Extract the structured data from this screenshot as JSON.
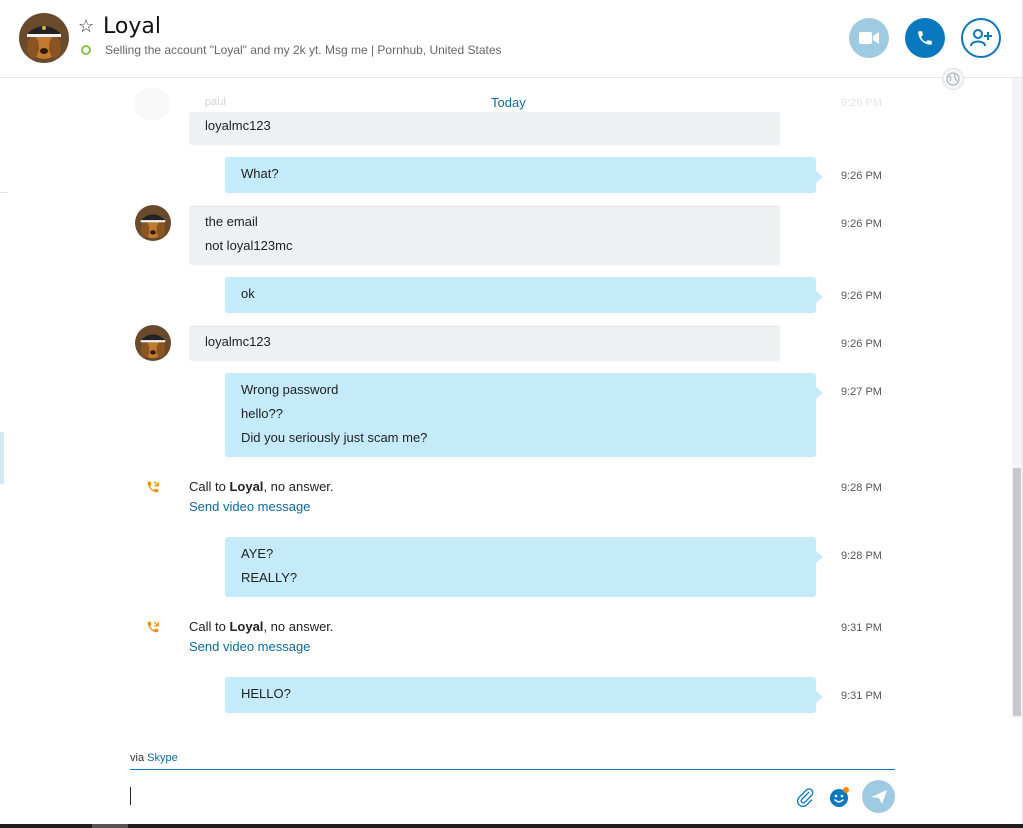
{
  "header": {
    "contact_name": "Loyal",
    "mood_message": "Selling the account \"Loyal\" and my 2k yt. Msg me  |  Pornhub, United States"
  },
  "conversation": {
    "date_divider": "Today",
    "faded_top": {
      "name": "paul",
      "time": "9:26 PM"
    },
    "partial_message": "loyalmc123",
    "messages": [
      {
        "lines": [
          "What?"
        ],
        "time": "9:26 PM"
      },
      {
        "lines": [
          "the email",
          "not loyal123mc"
        ],
        "time": "9:26 PM"
      },
      {
        "lines": [
          "ok"
        ],
        "time": "9:26 PM"
      },
      {
        "lines": [
          "loyalmc123"
        ],
        "time": "9:26 PM"
      },
      {
        "lines": [
          "Wrong password",
          "hello??",
          "Did you seriously just scam me?"
        ],
        "time": "9:27 PM"
      },
      {
        "call_prefix": "Call to ",
        "call_name": "Loyal",
        "call_suffix": ", no answer.",
        "link": "Send video message",
        "time": "9:28 PM"
      },
      {
        "lines": [
          "AYE?",
          "REALLY?"
        ],
        "time": "9:28 PM"
      },
      {
        "call_prefix": "Call to ",
        "call_name": "Loyal",
        "call_suffix": ", no answer.",
        "link": "Send video message",
        "time": "9:31 PM"
      },
      {
        "lines": [
          "HELLO?"
        ],
        "time": "9:31 PM"
      }
    ]
  },
  "composer": {
    "via_prefix": "via ",
    "via_service": "Skype"
  },
  "icons": {
    "star": "star-icon",
    "video": "video-call-icon",
    "call": "phone-icon",
    "add_person": "add-person-icon",
    "globe": "globe-icon",
    "missed_call": "missed-call-icon",
    "attach": "paperclip-icon",
    "emoji": "emoji-icon",
    "send": "send-icon"
  },
  "colors": {
    "accent": "#0a78be",
    "outgoing_bubble": "#c5eafa",
    "incoming_bubble": "#eef0f2",
    "link": "#0b6b9c",
    "status_online": "#8bc34a",
    "missed_call": "#f08c00"
  }
}
